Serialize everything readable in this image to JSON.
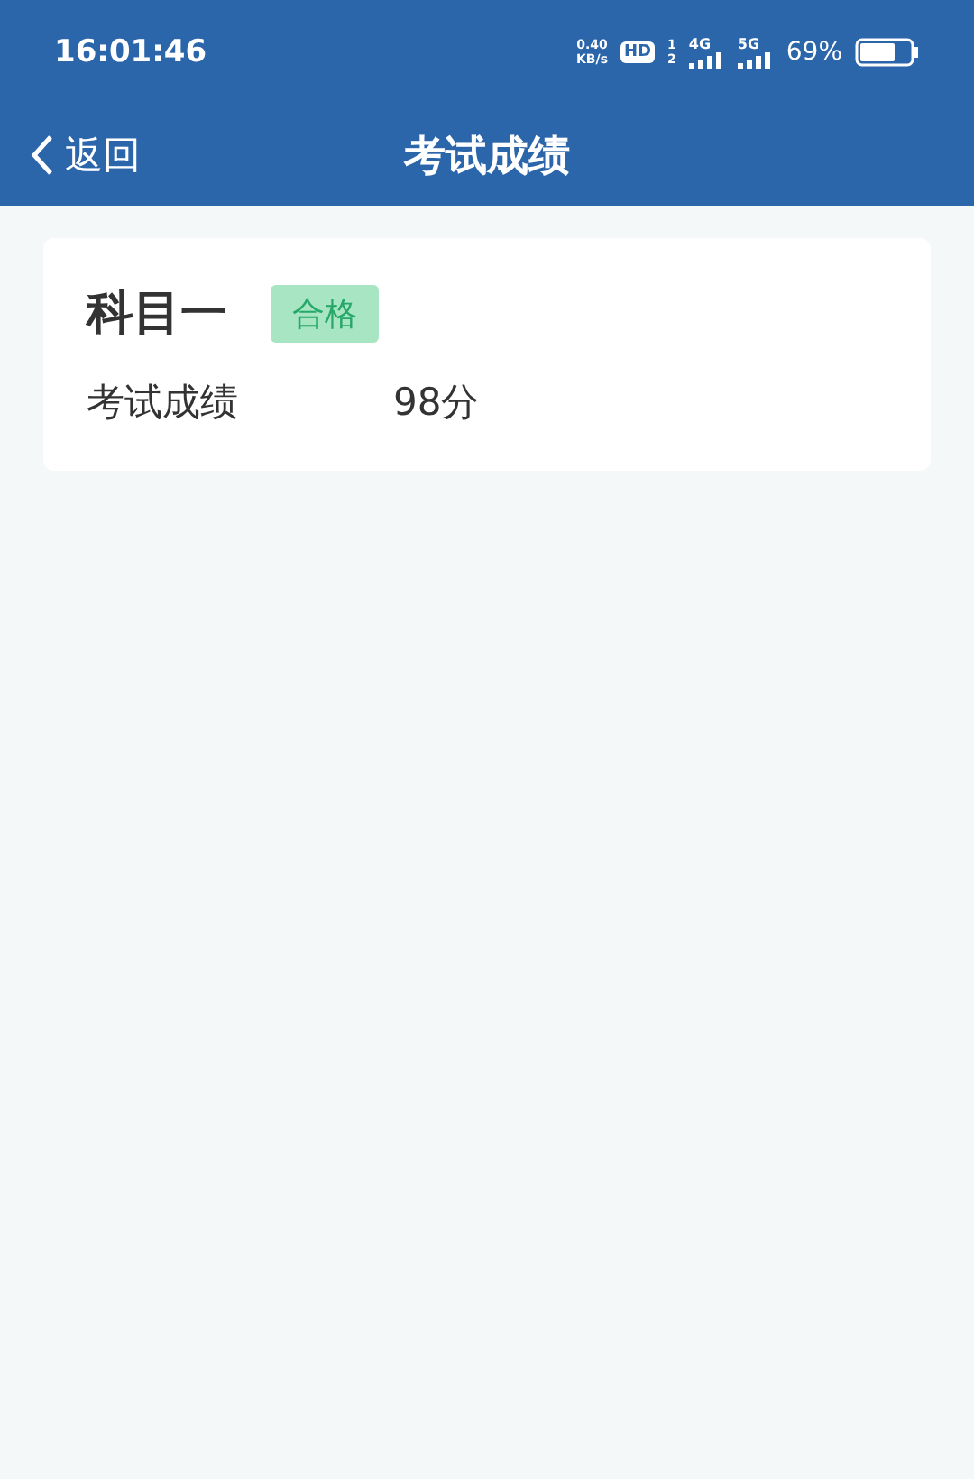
{
  "status_bar": {
    "time": "16:01:46",
    "net_speed": [
      "0.40",
      "KB/s"
    ],
    "hd": {
      "label": "HD",
      "sims": [
        "1",
        "2"
      ]
    },
    "networks": [
      "4G",
      "5G"
    ],
    "battery_text": "69%"
  },
  "header": {
    "back": "返回",
    "title": "考试成绩"
  },
  "results": [
    {
      "subject": "科目一",
      "status": "合格",
      "passed": true,
      "label": "考试成绩",
      "score": "98分"
    }
  ]
}
